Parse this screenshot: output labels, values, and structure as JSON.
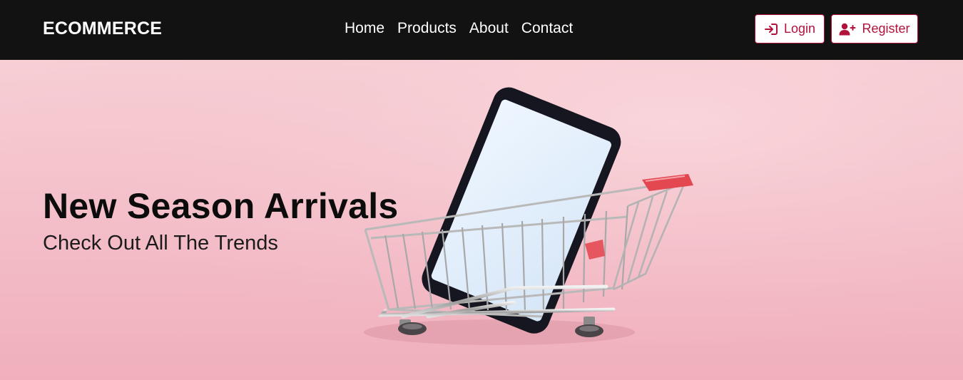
{
  "navbar": {
    "brand": "ECOMMERCE",
    "links": [
      {
        "label": "Home"
      },
      {
        "label": "Products"
      },
      {
        "label": "About"
      },
      {
        "label": "Contact"
      }
    ],
    "login": {
      "label": "Login",
      "icon": "sign-in-icon"
    },
    "register": {
      "label": "Register",
      "icon": "user-plus-icon"
    }
  },
  "hero": {
    "title": "New Season Arrivals",
    "subtitle": "Check Out All The Trends",
    "image": "shopping-cart-with-smartphone"
  },
  "colors": {
    "navbar_bg": "#131213",
    "accent": "#b0123b",
    "hero_bg": "#f4c0c9"
  }
}
